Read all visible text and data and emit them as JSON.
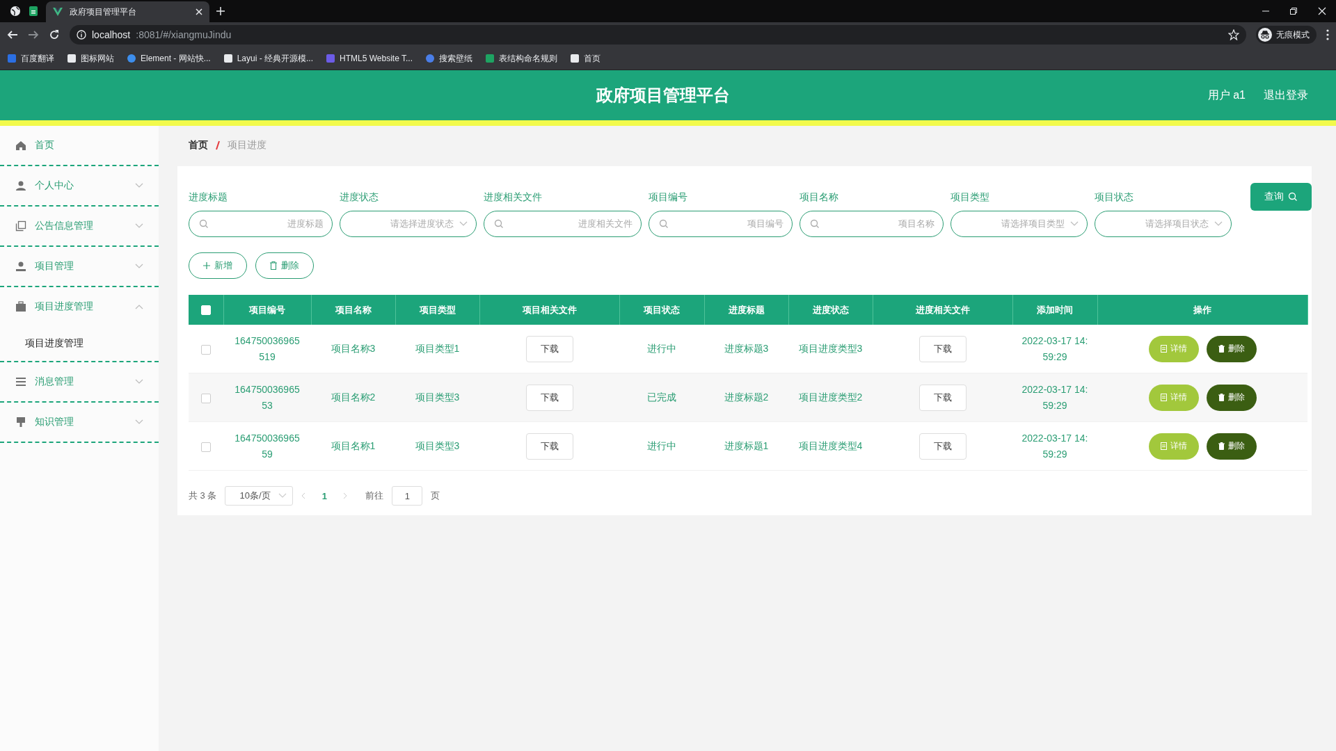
{
  "browser": {
    "tabs": [
      {
        "title": "政府项目管理平台",
        "selected": true
      }
    ],
    "address": {
      "host": "localhost",
      "rest": ":8081/#/xiangmuJindu"
    },
    "profile": "无痕模式",
    "bookmarks": [
      "百度翻译",
      "图标网站",
      "Element - 网站快...",
      "Layui - 经典开源模...",
      "HTML5 Website T...",
      "搜索壁纸",
      "表结构命名规则",
      "首页"
    ]
  },
  "header": {
    "title": "政府项目管理平台",
    "user": "用户 a1",
    "logout": "退出登录"
  },
  "sidebar": {
    "items": [
      {
        "label": "首页",
        "kind": "link"
      },
      {
        "label": "个人中心",
        "kind": "menu",
        "expanded": false
      },
      {
        "label": "公告信息管理",
        "kind": "menu",
        "expanded": false
      },
      {
        "label": "项目管理",
        "kind": "menu",
        "expanded": false
      },
      {
        "label": "项目进度管理",
        "kind": "menu",
        "expanded": true,
        "children": [
          {
            "label": "项目进度管理"
          }
        ]
      },
      {
        "label": "消息管理",
        "kind": "menu",
        "expanded": false
      },
      {
        "label": "知识管理",
        "kind": "menu",
        "expanded": false
      }
    ]
  },
  "breadcrumb": [
    "首页",
    "项目进度"
  ],
  "filters": [
    {
      "label": "进度标题",
      "kind": "search",
      "placeholder": "进度标题"
    },
    {
      "label": "进度状态",
      "kind": "select",
      "placeholder": "请选择进度状态"
    },
    {
      "label": "进度相关文件",
      "kind": "search",
      "placeholder": "进度相关文件"
    },
    {
      "label": "项目编号",
      "kind": "search",
      "placeholder": "项目编号"
    },
    {
      "label": "项目名称",
      "kind": "search",
      "placeholder": "项目名称"
    },
    {
      "label": "项目类型",
      "kind": "select",
      "placeholder": "请选择项目类型"
    },
    {
      "label": "项目状态",
      "kind": "select",
      "placeholder": "请选择项目状态"
    }
  ],
  "search_button": "查询",
  "actions": [
    {
      "label": "新增",
      "kind": "add"
    },
    {
      "label": "删除",
      "kind": "delete"
    }
  ],
  "table": {
    "header_checked": false,
    "columns": [
      "项目编号",
      "项目名称",
      "项目类型",
      "项目相关文件",
      "项目状态",
      "进度标题",
      "进度状态",
      "进度相关文件",
      "添加时间",
      "操作"
    ],
    "rows": [
      {
        "checked": false,
        "cells": [
          {
            "kind": "text",
            "text": "164750036965519"
          },
          {
            "kind": "text",
            "text": "项目名称3"
          },
          {
            "kind": "text",
            "text": "项目类型1"
          },
          {
            "kind": "button",
            "text": "下载"
          },
          {
            "kind": "text",
            "text": "进行中"
          },
          {
            "kind": "text",
            "text": "进度标题3"
          },
          {
            "kind": "text",
            "text": "项目进度类型3"
          },
          {
            "kind": "button",
            "text": "下载"
          },
          {
            "kind": "text",
            "text": "2022-03-17 14:59:29"
          },
          {
            "kind": "actions",
            "buttons": [
              {
                "kind": "detail",
                "label": "详情"
              },
              {
                "kind": "delete",
                "label": "删除"
              }
            ]
          }
        ]
      },
      {
        "checked": false,
        "cells": [
          {
            "kind": "text",
            "text": "16475003696553"
          },
          {
            "kind": "text",
            "text": "项目名称2"
          },
          {
            "kind": "text",
            "text": "项目类型3"
          },
          {
            "kind": "button",
            "text": "下载"
          },
          {
            "kind": "text",
            "text": "已完成"
          },
          {
            "kind": "text",
            "text": "进度标题2"
          },
          {
            "kind": "text",
            "text": "项目进度类型2"
          },
          {
            "kind": "button",
            "text": "下载"
          },
          {
            "kind": "text",
            "text": "2022-03-17 14:59:29"
          },
          {
            "kind": "actions",
            "buttons": [
              {
                "kind": "detail",
                "label": "详情"
              },
              {
                "kind": "delete",
                "label": "删除"
              }
            ]
          }
        ]
      },
      {
        "checked": false,
        "cells": [
          {
            "kind": "text",
            "text": "16475003696559"
          },
          {
            "kind": "text",
            "text": "项目名称1"
          },
          {
            "kind": "text",
            "text": "项目类型3"
          },
          {
            "kind": "button",
            "text": "下载"
          },
          {
            "kind": "text",
            "text": "进行中"
          },
          {
            "kind": "text",
            "text": "进度标题1"
          },
          {
            "kind": "text",
            "text": "项目进度类型4"
          },
          {
            "kind": "button",
            "text": "下载"
          },
          {
            "kind": "text",
            "text": "2022-03-17 14:59:29"
          },
          {
            "kind": "actions",
            "buttons": [
              {
                "kind": "detail",
                "label": "详情"
              },
              {
                "kind": "delete",
                "label": "删除"
              }
            ]
          }
        ]
      }
    ]
  },
  "pagination": {
    "total": "共 3 条",
    "page_size": "10条/页",
    "pages": [
      {
        "label": "1",
        "selected": true
      }
    ],
    "goto_label": "前往",
    "goto_value": "1",
    "goto_suffix": "页"
  }
}
